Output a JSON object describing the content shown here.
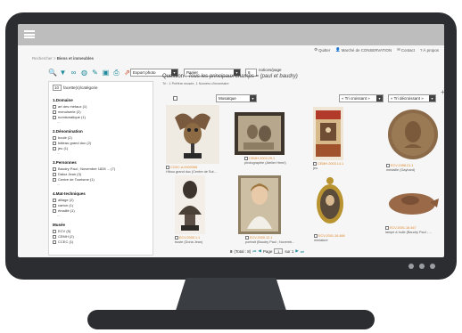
{
  "header": {
    "breadcrumb_prefix": "Rechercher",
    "breadcrumb_sep": ">",
    "breadcrumb_current": "Biens et immeubles",
    "nav": [
      {
        "icon": "gear-icon",
        "label": "Quitter"
      },
      {
        "icon": "user-icon",
        "label": "Marché de CONSERVATION"
      },
      {
        "icon": "mail-icon",
        "label": "Contact"
      },
      {
        "icon": "help-icon",
        "label": "À propos"
      }
    ]
  },
  "toolbar": {
    "icons": [
      "search-icon",
      "filter-icon",
      "link-icon",
      "globe-icon",
      "tools-icon",
      "save-icon",
      "print-icon",
      "share-icon"
    ],
    "export_select": "Export photo",
    "basket_select": "Panier",
    "per_page_value": "8",
    "per_page_label": "notices/page"
  },
  "panel": {
    "facet_count_value": "10",
    "facet_count_label": "facette(s)/catégorie",
    "groups": [
      {
        "title": "1.Domaine",
        "items": [
          "art des métaux (1)",
          "menuiserie (2)",
          "numismatique (1)"
        ]
      },
      {
        "title": "2.Dénomination",
        "items": [
          "boule (2)",
          "bâteau grand duc (2)",
          "jeu (1)"
        ]
      },
      {
        "title": "3.Personnes",
        "items": [
          "Baudry Paul ; Novembre 1828 ... (7)",
          "Daloz Jean (3)",
          "Centre de Tourisme (1)"
        ]
      },
      {
        "title": "4.Mat-techniques",
        "items": [
          "alliage (2)",
          "carton (1)",
          "émaillé (1)"
        ]
      },
      {
        "title": "Musée",
        "items": [
          "ECV (5)",
          "CEMH (2)",
          "CCEC (1)"
        ]
      }
    ],
    "more_label": "..."
  },
  "results": {
    "question_label": "Question :",
    "question_text": "Tous les principaux champs = (paul et baudry)",
    "sub_text": "Tri : 1 Préfére musée, 1 Numéro d'inventaire",
    "view_select": "Mosaïque",
    "sort_asc_select": "« Tri croissant »",
    "sort_desc_select": "« Tri décroissant »",
    "plus_label": "+",
    "items": [
      {
        "ref": "CCEC.A.0000356",
        "title": "Hibou grand duc (Centre de Sot..."
      },
      {
        "ref": "CEMH.2003.29.1",
        "title": "photographie (Atelier Henri)"
      },
      {
        "ref": "CEMH.2003.14.1",
        "title": "jeu"
      },
      {
        "ref": "ECV.1998.21.1",
        "title": "médaille (Gayhard)"
      },
      {
        "ref": "ECV.2000.1.1",
        "title": "buste (Doria Jean)"
      },
      {
        "ref": "ECV.2000.12.1",
        "title": "portrait (Baudry Paul ; Novemb..."
      },
      {
        "ref": "ECV.2001.16.466",
        "title": "miniature"
      },
      {
        "ref": "ECV.2001.16.467",
        "title": "lampe à huile (Baudry Paul ; ..."
      }
    ],
    "pager": {
      "total": "8",
      "total_label": "(Total : 8)",
      "page_label": "Page",
      "page_value": "1",
      "of_label": "sur 1"
    }
  },
  "colors": {
    "accent": "#1e8a9b",
    "ref_orange": "#e08628",
    "bezel": "#2b2d30"
  }
}
